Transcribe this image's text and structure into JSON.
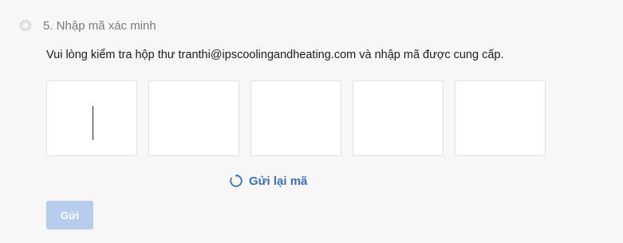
{
  "step": {
    "title": "5. Nhập mã xác minh"
  },
  "instruction": "Vui lòng kiểm tra hộp thư tranthi@ipscoolingandheating.com và nhập mã được cung cấp.",
  "code_inputs": {
    "count": 5,
    "values": [
      "",
      "",
      "",
      "",
      ""
    ],
    "focused_index": 0
  },
  "resend": {
    "label": "Gửi lại mã",
    "icon": "refresh-icon"
  },
  "submit": {
    "label": "Gửi",
    "enabled": false
  },
  "colors": {
    "page_bg": "#f7f7f7",
    "link": "#3a6fb8",
    "button_disabled_bg": "#b7cdee",
    "input_border": "#e1e1e1"
  }
}
